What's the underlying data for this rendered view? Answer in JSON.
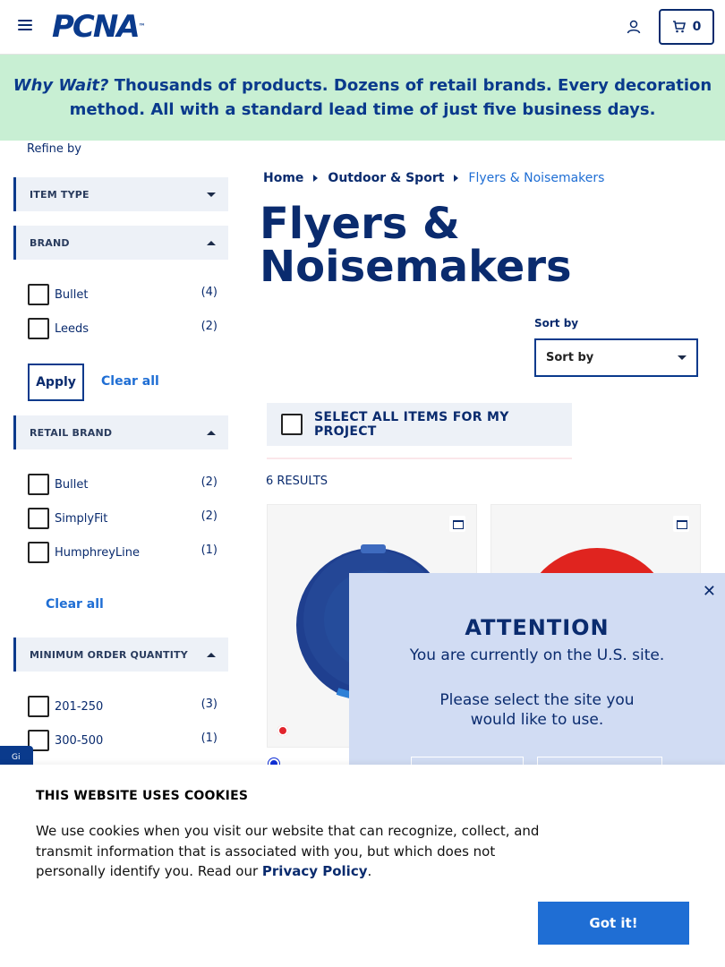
{
  "header": {
    "logo_text": "PCNA",
    "logo_tm": "™",
    "cart_count": "0"
  },
  "banner": {
    "lead": "Why Wait?",
    "text": "Thousands of products. Dozens of retail brands. Every decoration method. All with a standard lead time of just five business days."
  },
  "sidebar": {
    "refine_label": "Refine by",
    "facets": {
      "item_type": {
        "label": "ITEM TYPE"
      },
      "brand": {
        "label": "BRAND",
        "options": [
          {
            "label": "Bullet",
            "count": "(4)"
          },
          {
            "label": "Leeds",
            "count": "(2)"
          }
        ],
        "apply_label": "Apply",
        "clear_label": "Clear all"
      },
      "retail_brand": {
        "label": "RETAIL BRAND",
        "options": [
          {
            "label": "Bullet",
            "count": "(2)"
          },
          {
            "label": "SimplyFit",
            "count": "(2)"
          },
          {
            "label": "HumphreyLine",
            "count": "(1)"
          }
        ],
        "clear_label": "Clear all"
      },
      "min_order_qty": {
        "label": "MINIMUM ORDER QUANTITY",
        "options": [
          {
            "label": "201-250",
            "count": "(3)"
          },
          {
            "label": "300-500",
            "count": "(1)"
          }
        ]
      }
    },
    "side_tab_text": "Gi"
  },
  "breadcrumb": {
    "items": [
      "Home",
      "Outdoor & Sport"
    ],
    "current": "Flyers & Noisemakers"
  },
  "page_title": "Flyers & Noisemakers",
  "sort": {
    "label": "Sort by",
    "value": "Sort by"
  },
  "select_all_label": "SELECT ALL ITEMS FOR MY PROJECT",
  "results_label": "6 RESULTS",
  "products": [
    {
      "color": "#1f3f8f",
      "swatches": [
        "#e2242c",
        "#1030d8"
      ]
    },
    {
      "color": "#e0241f"
    }
  ],
  "modal": {
    "title": "ATTENTION",
    "line1": "You are currently on the U.S. site.",
    "line2": "Please select the site you would like to use.",
    "close": "✕"
  },
  "cookie": {
    "title": "THIS WEBSITE USES COOKIES",
    "text": "We use cookies when you visit our website that can recognize, collect, and transmit information that is associated with you, but which does not personally identify you. Read our ",
    "link": "Privacy Policy",
    "tail": ".",
    "button": "Got it!"
  },
  "colors": {
    "brand_navy": "#0a2b6e",
    "link_blue": "#1f6ed4",
    "banner_green": "#c8efd3",
    "modal_blue": "#d1dcf3"
  }
}
